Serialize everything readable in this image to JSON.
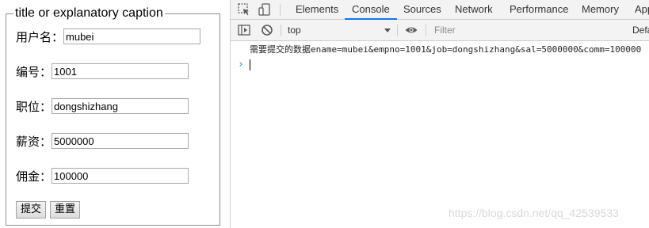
{
  "form": {
    "legend": "title or explanatory caption",
    "fields": [
      {
        "label": "用户名：",
        "value": "mubei"
      },
      {
        "label": "编号：",
        "value": "1001"
      },
      {
        "label": "职位：",
        "value": "dongshizhang"
      },
      {
        "label": "薪资：",
        "value": "5000000"
      },
      {
        "label": "佣金：",
        "value": "100000"
      }
    ],
    "submit_label": "提交",
    "reset_label": "重置"
  },
  "devtools": {
    "tabs": [
      "Elements",
      "Console",
      "Sources",
      "Network",
      "Performance",
      "Memory",
      "App"
    ],
    "active_tab": "Console",
    "context": "top",
    "filter_placeholder": "Filter",
    "levels_label": "Defa",
    "log": {
      "prefix": "需要提交的数据",
      "payload": "ename=mubei&empno=1001&job=dongshizhang&sal=5000000&comm=100000"
    },
    "prompt_symbol": "›",
    "accent_color": "#1a73e8"
  },
  "watermark": "https://blog.csdn.net/qq_42539533"
}
